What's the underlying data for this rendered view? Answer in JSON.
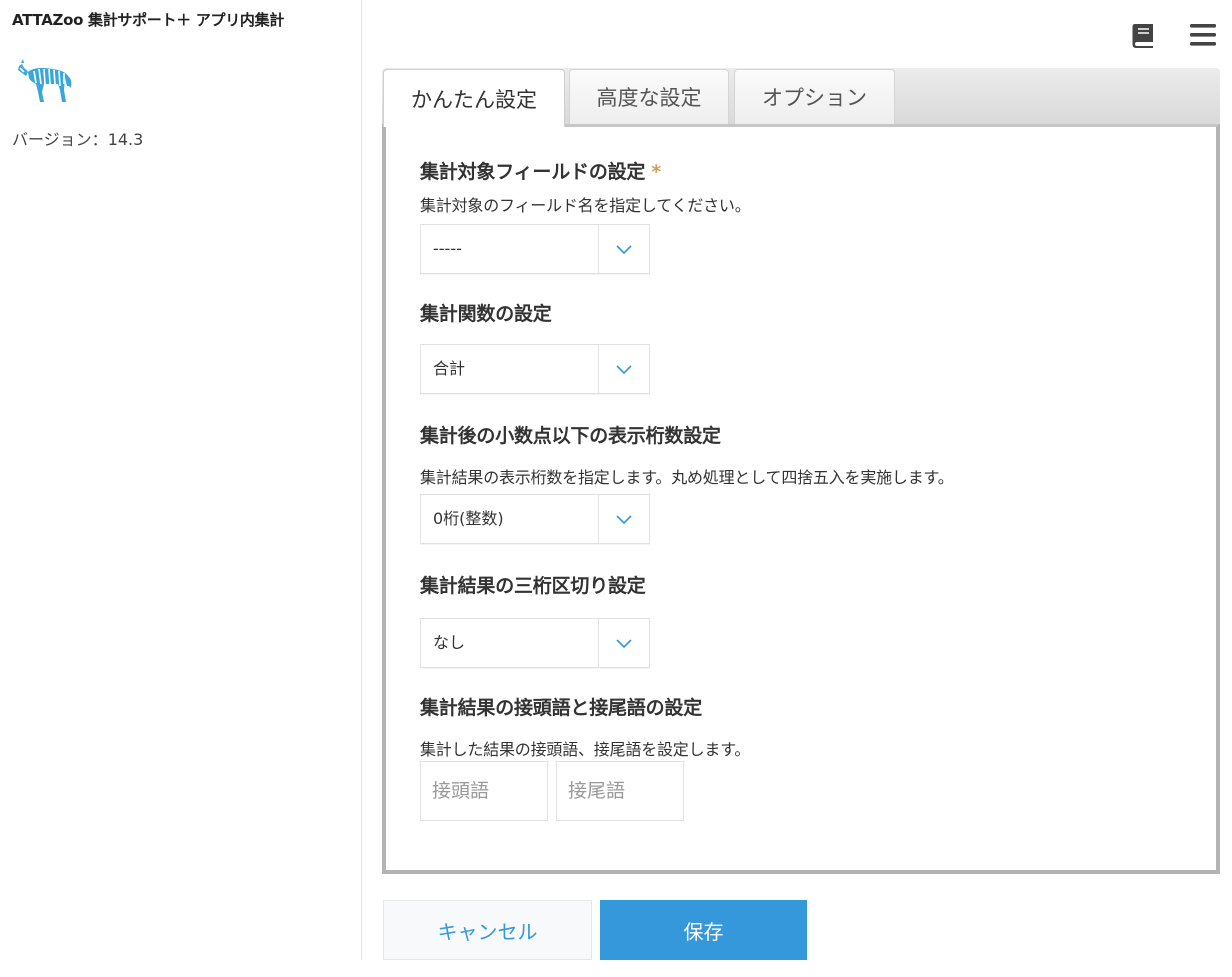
{
  "sidebar": {
    "app_title": "ATTAZoo 集計サポート＋ アプリ内集計",
    "logo_icon": "zebra-icon",
    "version_label": "バージョン：",
    "version_value": "14.3"
  },
  "header": {
    "icons": [
      "book-icon",
      "hamburger-menu-icon"
    ]
  },
  "tabs": [
    {
      "label": "かんたん設定",
      "active": true
    },
    {
      "label": "高度な設定",
      "active": false
    },
    {
      "label": "オプション",
      "active": false
    }
  ],
  "sections": {
    "target_field": {
      "title": "集計対象フィールドの設定",
      "required_mark": "*",
      "description": "集計対象のフィールド名を指定してください。",
      "value": "-----"
    },
    "function": {
      "title": "集計関数の設定",
      "value": "合計"
    },
    "decimal": {
      "title": "集計後の小数点以下の表示桁数設定",
      "description": "集計結果の表示桁数を指定します。丸め処理として四捨五入を実施します。",
      "value": "0桁(整数)"
    },
    "separator": {
      "title": "集計結果の三桁区切り設定",
      "value": "なし"
    },
    "affix": {
      "title": "集計結果の接頭語と接尾語の設定",
      "description": "集計した結果の接頭語、接尾語を設定します。",
      "prefix_placeholder": "接頭語",
      "suffix_placeholder": "接尾語",
      "prefix_value": "",
      "suffix_value": ""
    }
  },
  "buttons": {
    "cancel_label": "キャンセル",
    "save_label": "保存"
  },
  "colors": {
    "accent": "#3498db",
    "required": "#c9a067"
  }
}
